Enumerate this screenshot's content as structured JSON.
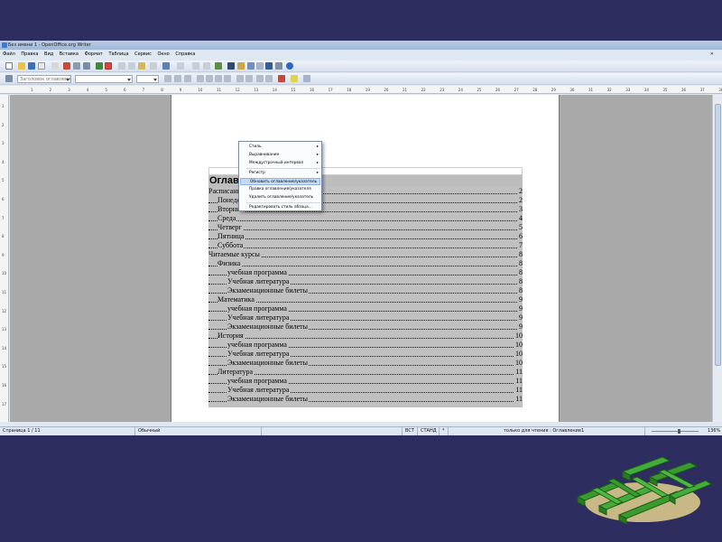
{
  "window": {
    "title": "Без имени 1 - OpenOffice.org Writer"
  },
  "menu": [
    "Файл",
    "Правка",
    "Вид",
    "Вставка",
    "Формат",
    "Таблица",
    "Сервис",
    "Окно",
    "Справка"
  ],
  "toolbar": {
    "style_combo": "Заголовок оглавления",
    "font_combo": "",
    "size_combo": ""
  },
  "ruler": {
    "h_ticks": [
      "1",
      "2",
      "3",
      "4",
      "5",
      "6",
      "7",
      "8",
      "9",
      "10",
      "11",
      "12",
      "13",
      "14",
      "15",
      "16",
      "17",
      "18",
      "19",
      "20",
      "21",
      "22",
      "23",
      "24",
      "25",
      "26",
      "27",
      "28",
      "29",
      "30",
      "31",
      "32",
      "33",
      "34",
      "35",
      "36",
      "37",
      "38"
    ],
    "v_ticks": [
      "1",
      "2",
      "3",
      "4",
      "5",
      "6",
      "7",
      "8",
      "9",
      "10",
      "11",
      "12",
      "13",
      "14",
      "15",
      "16",
      "17"
    ]
  },
  "document": {
    "title": "Оглавление",
    "entries": [
      {
        "text": "Расписание",
        "page": "2",
        "level": 0
      },
      {
        "text": "Понедельник",
        "page": "2",
        "level": 1
      },
      {
        "text": "Вторник",
        "page": "3",
        "level": 1
      },
      {
        "text": "Среда",
        "page": "4",
        "level": 1
      },
      {
        "text": "Четверг",
        "page": "5",
        "level": 1
      },
      {
        "text": "Пятница",
        "page": "6",
        "level": 1
      },
      {
        "text": "Суббота",
        "page": "7",
        "level": 1
      },
      {
        "text": "Читаемые курсы",
        "page": "8",
        "level": 0
      },
      {
        "text": "Физика",
        "page": "8",
        "level": 1
      },
      {
        "text": "учебная программа",
        "page": "8",
        "level": 2
      },
      {
        "text": "Учебная литература",
        "page": "8",
        "level": 2
      },
      {
        "text": "Экзаменационные билеты",
        "page": "8",
        "level": 2
      },
      {
        "text": "Математика",
        "page": "9",
        "level": 1
      },
      {
        "text": "учебная программа",
        "page": "9",
        "level": 2
      },
      {
        "text": "Учебная литература",
        "page": "9",
        "level": 2
      },
      {
        "text": "Экзаменационные билеты",
        "page": "9",
        "level": 2
      },
      {
        "text": "История",
        "page": "10",
        "level": 1
      },
      {
        "text": "учебная программа",
        "page": "10",
        "level": 2
      },
      {
        "text": "Учебная литература",
        "page": "10",
        "level": 2
      },
      {
        "text": "Экзаменационные билеты",
        "page": "10",
        "level": 2
      },
      {
        "text": "Литература",
        "page": "11",
        "level": 1
      },
      {
        "text": "учебная программа",
        "page": "11",
        "level": 2
      },
      {
        "text": "Учебная литература",
        "page": "11",
        "level": 2
      },
      {
        "text": "Экзаменационные билеты",
        "page": "11",
        "level": 2
      }
    ]
  },
  "context_menu": {
    "items": [
      {
        "label": "Стиль",
        "submenu": true
      },
      {
        "label": "Выравнивание",
        "submenu": true
      },
      {
        "label": "Междустрочный интервал",
        "submenu": true
      },
      {
        "label": "Регистр",
        "submenu": true
      },
      {
        "label": "Обновить оглавление/указатель",
        "submenu": false,
        "highlighted": true
      },
      {
        "label": "Правка оглавления/указателя",
        "submenu": false
      },
      {
        "label": "Удалить оглавление/указатель",
        "submenu": false
      },
      {
        "label": "Редактировать стиль абзаца...",
        "submenu": false
      }
    ]
  },
  "status": {
    "page": "Страница 1 / 11",
    "style": "Обычный",
    "insert_mode": "ВСТ",
    "selection_mode": "СТАНД",
    "modified": "*",
    "section": "только для чтения : Оглавление1",
    "zoom": "136%"
  },
  "colors": {
    "background": "#2e2d5f",
    "field_shading": "#c0c0c0",
    "highlight": "#c6dcf6",
    "logo_green": "#3a9a2e"
  }
}
